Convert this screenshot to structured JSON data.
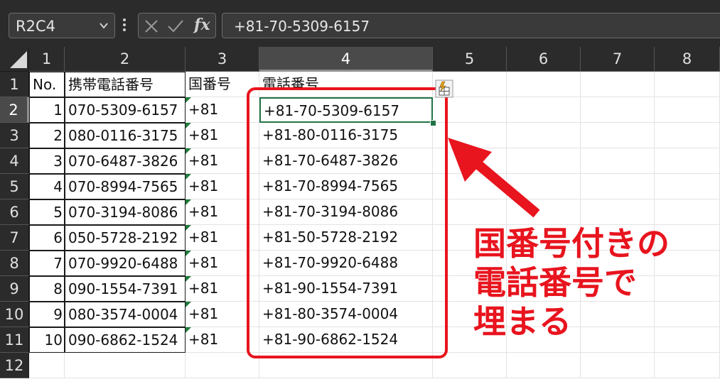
{
  "formula_bar": {
    "namebox": "R2C4",
    "formula": "+81-70-5309-6157",
    "icons": [
      "cancel-icon",
      "enter-icon",
      "fx-icon"
    ],
    "fx_label": "fx"
  },
  "columns": [
    "1",
    "2",
    "3",
    "4",
    "5",
    "6",
    "7",
    "8"
  ],
  "active_column": "4",
  "row_numbers": [
    "1",
    "2",
    "3",
    "4",
    "5",
    "6",
    "7",
    "8",
    "9",
    "10",
    "11",
    "12"
  ],
  "active_row": "2",
  "headers": {
    "no": "No.",
    "mobile": "携帯電話番号",
    "country_code": "国番号",
    "phone": "電話番号"
  },
  "rows": [
    {
      "no": "1",
      "mobile": "070-5309-6157",
      "country_code": "+81",
      "phone": "+81-70-5309-6157"
    },
    {
      "no": "2",
      "mobile": "080-0116-3175",
      "country_code": "+81",
      "phone": "+81-80-0116-3175"
    },
    {
      "no": "3",
      "mobile": "070-6487-3826",
      "country_code": "+81",
      "phone": "+81-70-6487-3826"
    },
    {
      "no": "4",
      "mobile": "070-8994-7565",
      "country_code": "+81",
      "phone": "+81-70-8994-7565"
    },
    {
      "no": "5",
      "mobile": "070-3194-8086",
      "country_code": "+81",
      "phone": "+81-70-3194-8086"
    },
    {
      "no": "6",
      "mobile": "050-5728-2192",
      "country_code": "+81",
      "phone": "+81-50-5728-2192"
    },
    {
      "no": "7",
      "mobile": "070-9920-6488",
      "country_code": "+81",
      "phone": "+81-70-9920-6488"
    },
    {
      "no": "8",
      "mobile": "090-1554-7391",
      "country_code": "+81",
      "phone": "+81-90-1554-7391"
    },
    {
      "no": "9",
      "mobile": "080-3574-0004",
      "country_code": "+81",
      "phone": "+81-80-3574-0004"
    },
    {
      "no": "10",
      "mobile": "090-6862-1524",
      "country_code": "+81",
      "phone": "+81-90-6862-1524"
    }
  ],
  "annotation": {
    "lines": [
      "国番号付きの",
      "電話番号で",
      "埋まる"
    ],
    "color": "#e8141e"
  },
  "colors": {
    "header_bg": "#2b2b2b",
    "selection": "#217346",
    "annotation": "#e8141e"
  }
}
